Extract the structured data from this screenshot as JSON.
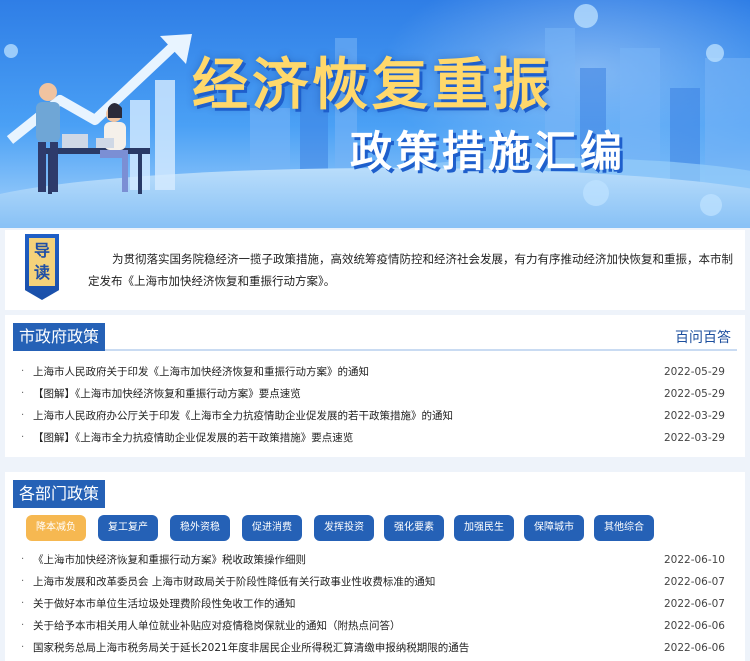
{
  "banner": {
    "title": "经济恢复重振",
    "subtitle": "政策措施汇编"
  },
  "intro": {
    "tag_char_1": "导",
    "tag_char_2": "读",
    "text": "为贯彻落实国务院稳经济一揽子政策措施，高效统筹疫情防控和经济社会发展，有力有序推动经济加快恢复和重振，本市制定发布《上海市加快经济恢复和重振行动方案》。"
  },
  "city_policy": {
    "title": "市政府政策",
    "link": "百问百答",
    "items": [
      {
        "text": "上海市人民政府关于印发《上海市加快经济恢复和重振行动方案》的通知",
        "date": "2022-05-29"
      },
      {
        "text": "【图解】《上海市加快经济恢复和重振行动方案》要点速览",
        "date": "2022-05-29"
      },
      {
        "text": "上海市人民政府办公厅关于印发《上海市全力抗疫情助企业促发展的若干政策措施》的通知",
        "date": "2022-03-29"
      },
      {
        "text": "【图解】《上海市全力抗疫情助企业促发展的若干政策措施》要点速览",
        "date": "2022-03-29"
      }
    ]
  },
  "dept_policy": {
    "title": "各部门政策",
    "tabs": [
      "降本减负纾困",
      "复工复产复市",
      "稳外资稳外贸",
      "促进消费恢复",
      "发挥投资作用",
      "强化要素保障",
      "加强民生保障",
      "保障城市运行",
      "其他综合政策"
    ],
    "active_tab": "降本减负纾困",
    "items": [
      {
        "text": "《上海市加快经济恢复和重振行动方案》税收政策操作细则",
        "date": "2022-06-10"
      },
      {
        "text": "上海市发展和改革委员会 上海市财政局关于阶段性降低有关行政事业性收费标准的通知",
        "date": "2022-06-07"
      },
      {
        "text": "关于做好本市单位生活垃圾处理费阶段性免收工作的通知",
        "date": "2022-06-07"
      },
      {
        "text": "关于给予本市相关用人单位就业补贴应对疫情稳岗保就业的通知（附热点问答）",
        "date": "2022-06-06"
      },
      {
        "text": "国家税务总局上海市税务局关于延长2021年度非居民企业所得税汇算清缴申报纳税期限的通告",
        "date": "2022-06-06"
      }
    ]
  },
  "colors": {
    "primary": "#2561b6",
    "active_tab": "#f6b851",
    "title_gold": "#ffd86b"
  }
}
